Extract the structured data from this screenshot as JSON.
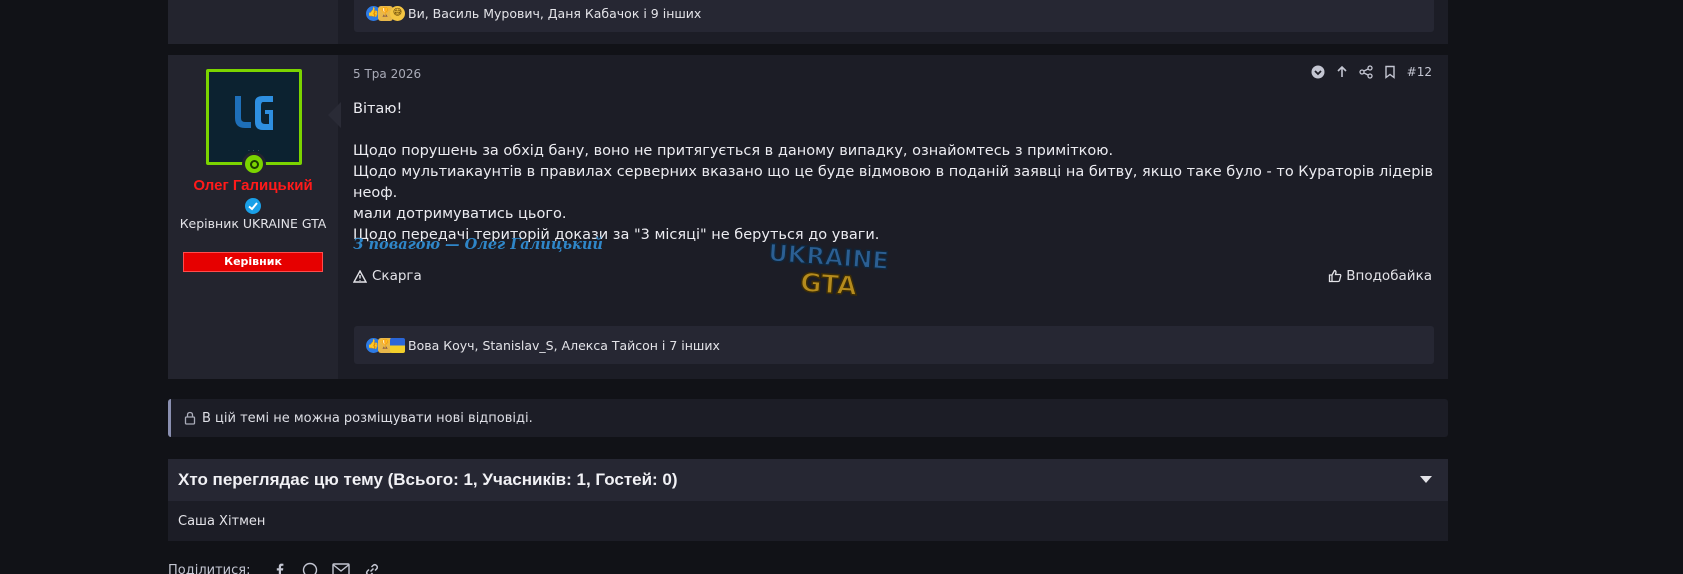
{
  "previous_post": {
    "reactions": {
      "icons": [
        "like-icon",
        "trophy-icon",
        "emoji-icon"
      ],
      "text": "Ви, Василь Мурович, Даня Кабачок і 9 інших"
    }
  },
  "post": {
    "date": "5 Тра 2026",
    "number": "#12",
    "author": {
      "name": "Олег Галицький",
      "title": "Керівник UKRAINE GTA",
      "banner": "Керівник",
      "name_color": "#ff1a1a",
      "avatar_border": "#7bd400",
      "banner_color": "#e60000"
    },
    "body": {
      "greeting": "Вітаю!",
      "line1": "Щодо порушень за обхід бану, воно не притягується в даному випадку, ознайомтесь з приміткою.",
      "line2": "Щодо мультиакаунтів в правилах серверних вказано що це буде відмовою в поданій заявці на битву, якщо таке було - то Кураторів лідерів неоф.",
      "line3": "мали дотримуватись цього.",
      "line4": "Щодо передачі територій докази за \"3 місяці\" не беруться до уваги."
    },
    "signature": "З повагою — Олег Галицький",
    "signature_color": "#2f86c8",
    "report_label": "Скарга",
    "like_label": "Вподобайка",
    "reactions": {
      "icons": [
        "like-icon",
        "trophy-icon",
        "ukraine-flag-icon"
      ],
      "text": "Вова Коуч, Stanislav_S, Алекса Тайсон і 7 інших"
    }
  },
  "notice": {
    "text": "В цій темі не можна розміщувати нові відповіді."
  },
  "viewers": {
    "title": "Хто переглядає цю тему (Всього: 1, Учасників: 1, Гостей: 0)",
    "names": "Саша Хітмен"
  },
  "share": {
    "label": "Поділитися:",
    "icons": [
      "facebook-icon",
      "whatsapp-icon",
      "email-icon",
      "link-icon"
    ]
  }
}
